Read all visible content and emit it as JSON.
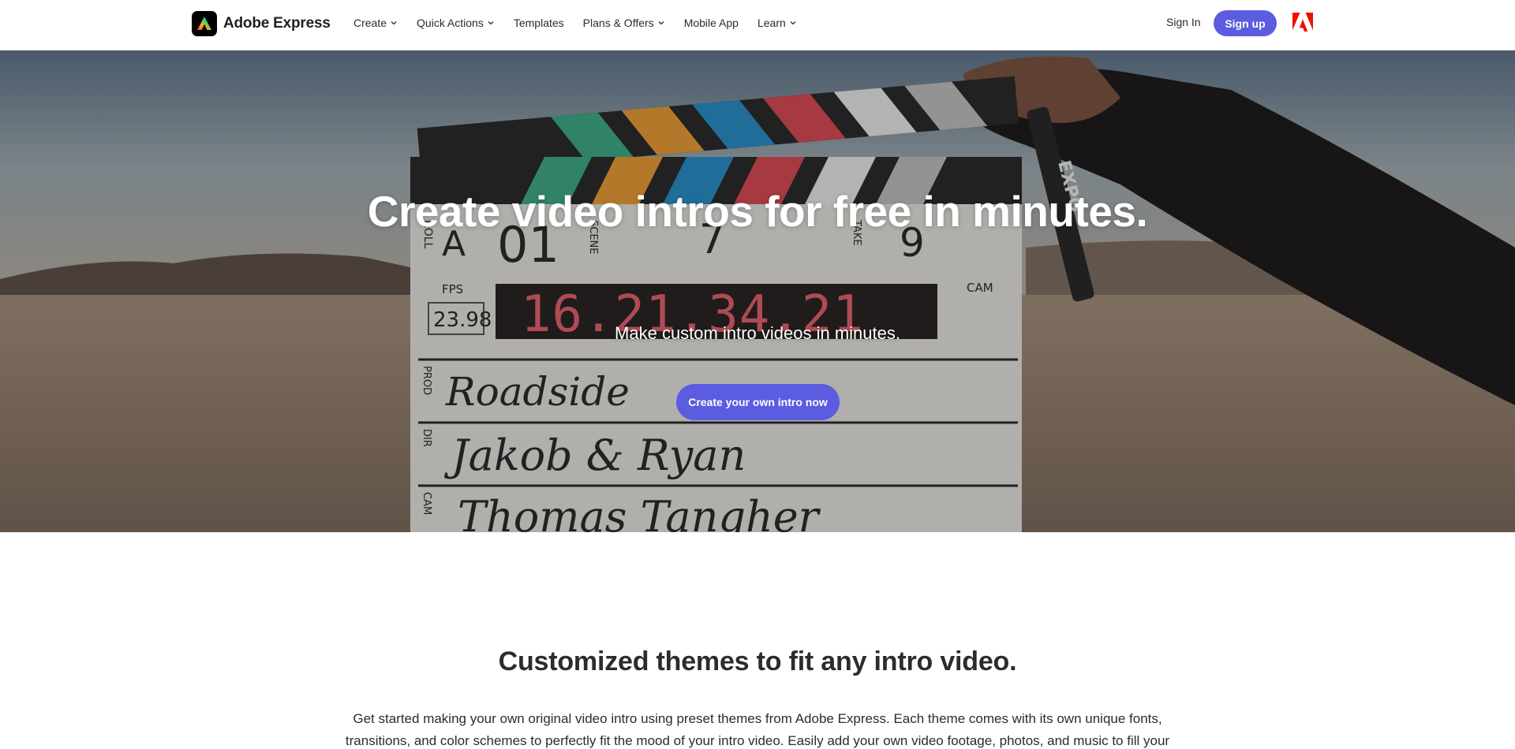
{
  "nav": {
    "brand_name": "Adobe Express",
    "items": [
      {
        "label": "Create",
        "has_dropdown": true
      },
      {
        "label": "Quick Actions",
        "has_dropdown": true
      },
      {
        "label": "Templates",
        "has_dropdown": false
      },
      {
        "label": "Plans & Offers",
        "has_dropdown": true
      },
      {
        "label": "Mobile App",
        "has_dropdown": false
      },
      {
        "label": "Learn",
        "has_dropdown": true
      }
    ],
    "sign_in": "Sign In",
    "sign_up": "Sign up"
  },
  "hero": {
    "title": "Create video intros for free in minutes.",
    "subtitle": "Make custom intro videos in minutes.",
    "cta": "Create your own intro now",
    "slate": {
      "roll": "ROLL",
      "scene": "SCENE",
      "take": "TAKE",
      "roll_value": "A",
      "scene_value": "01",
      "scene_value2": "7",
      "take_value": "9",
      "fps_label": "FPS",
      "fps_value": "23.98",
      "cam": "CAM",
      "timecode": "16.21.34.21",
      "prod_label": "PROD",
      "prod_value": "Roadside",
      "dir_label": "DIR",
      "dir_value": "Jakob & Ryan",
      "cam_label": "CAM",
      "cam_value": "Thomas Tangher",
      "marker_brand": "EXPO"
    }
  },
  "section": {
    "title": "Customized themes to fit any intro video.",
    "body": "Get started making your own original video intro using preset themes from Adobe Express. Each theme comes with its own unique fonts, transitions, and color schemes to perfectly fit the mood of your intro video. Easily add your own video footage, photos, and music to fill your"
  },
  "colors": {
    "accent": "#5c5ce0",
    "adobe_red": "#eb1000",
    "text": "#2c2c2c"
  },
  "icons": {
    "brand": "adobe-express-logo-icon",
    "dropdown": "chevron-down-icon",
    "adobe": "adobe-logo-icon"
  }
}
